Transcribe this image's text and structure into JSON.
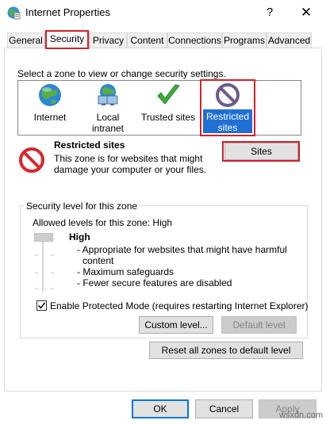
{
  "window": {
    "title": "Internet Properties",
    "help_label": "?",
    "close_label": "✕"
  },
  "tabs": [
    {
      "label": "General"
    },
    {
      "label": "Security"
    },
    {
      "label": "Privacy"
    },
    {
      "label": "Content"
    },
    {
      "label": "Connections"
    },
    {
      "label": "Programs"
    },
    {
      "label": "Advanced"
    }
  ],
  "active_tab": "Security",
  "zones": {
    "prompt": "Select a zone to view or change security settings.",
    "items": [
      {
        "label_line1": "Internet",
        "label_line2": "",
        "icon": "globe-icon"
      },
      {
        "label_line1": "Local intranet",
        "label_line2": "",
        "icon": "intranet-icon"
      },
      {
        "label_line1": "Trusted sites",
        "label_line2": "",
        "icon": "checkmark-icon"
      },
      {
        "label_line1": "Restricted",
        "label_line2": "sites",
        "icon": "restricted-icon"
      }
    ],
    "selected": "Restricted sites"
  },
  "zone_description": {
    "title": "Restricted sites",
    "text": "This zone is for websites that might damage your computer or your files.",
    "sites_button": "Sites"
  },
  "security_level": {
    "group_label": "Security level for this zone",
    "allowed_levels": "Allowed levels for this zone: High",
    "level_name": "High",
    "bullets": [
      "- Appropriate for websites that might have harmful",
      "content",
      "- Maximum safeguards",
      "- Fewer secure features are disabled"
    ],
    "protected_mode_label": "Enable Protected Mode (requires restarting Internet Explorer)",
    "protected_mode_checked": true,
    "custom_level_button": "Custom level...",
    "default_level_button": "Default level",
    "reset_all_button": "Reset all zones to default level"
  },
  "footer": {
    "ok": "OK",
    "cancel": "Cancel",
    "apply": "Apply"
  },
  "watermark": "wsxdn.com",
  "colors": {
    "highlight_red": "#d22128",
    "selection_blue": "#1f6fd4",
    "button_face": "#e1e1e1",
    "accent_blue": "#0078d7"
  }
}
